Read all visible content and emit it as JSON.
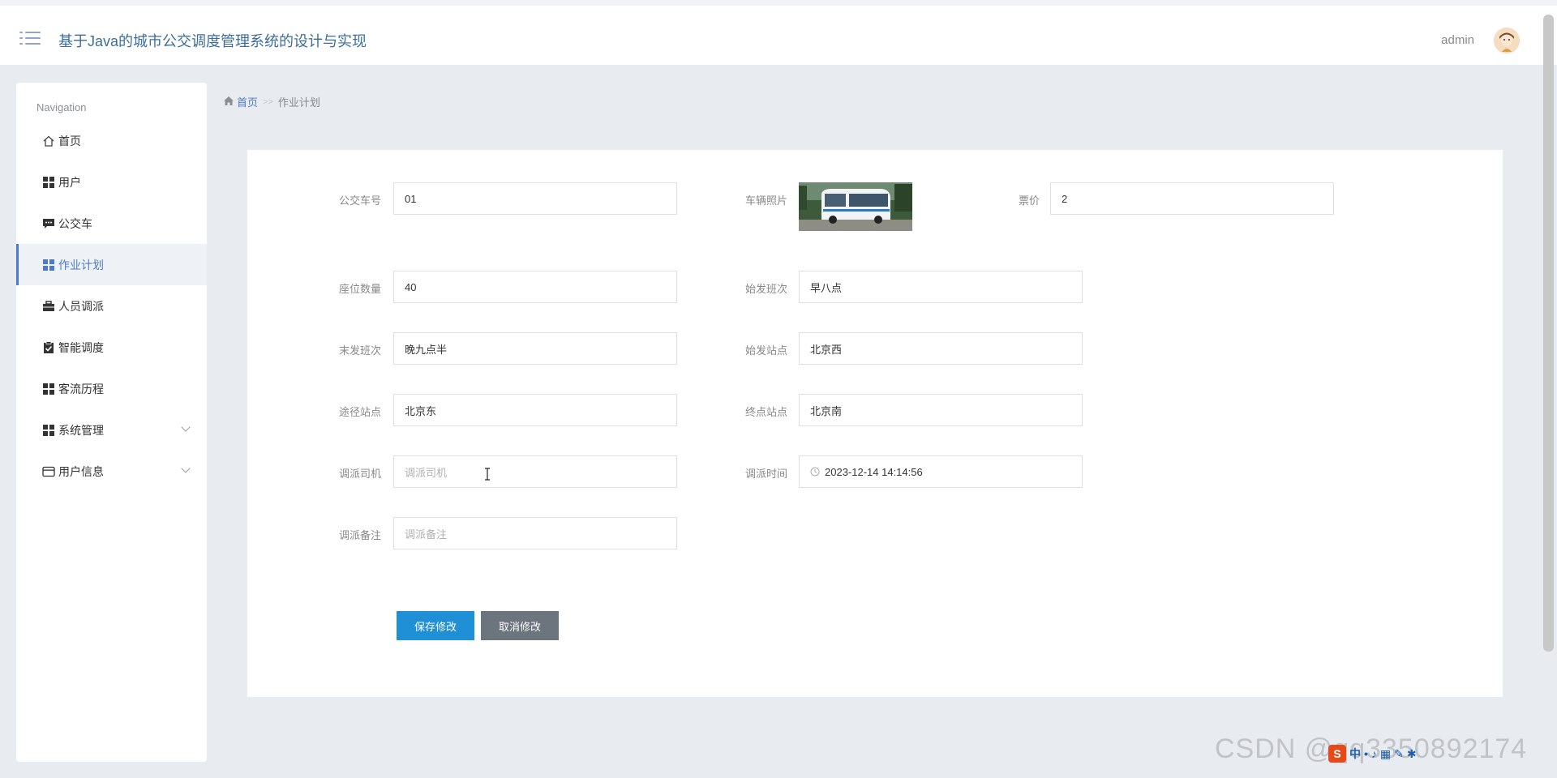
{
  "header": {
    "title": "基于Java的城市公交调度管理系统的设计与实现",
    "user": "admin"
  },
  "sidebar": {
    "heading": "Navigation",
    "items": [
      {
        "label": "首页",
        "icon": "home-icon"
      },
      {
        "label": "用户",
        "icon": "grid-icon"
      },
      {
        "label": "公交车",
        "icon": "chat-icon"
      },
      {
        "label": "作业计划",
        "icon": "grid-icon",
        "active": true
      },
      {
        "label": "人员调派",
        "icon": "briefcase-icon"
      },
      {
        "label": "智能调度",
        "icon": "clipboard-check-icon"
      },
      {
        "label": "客流历程",
        "icon": "grid-icon"
      },
      {
        "label": "系统管理",
        "icon": "grid-icon",
        "expandable": true
      },
      {
        "label": "用户信息",
        "icon": "id-card-icon",
        "expandable": true
      }
    ]
  },
  "breadcrumb": {
    "home": "首页",
    "separator": ">>",
    "current": "作业计划"
  },
  "form": {
    "bus_no": {
      "label": "公交车号",
      "value": "01"
    },
    "photo": {
      "label": "车辆照片"
    },
    "fare": {
      "label": "票价",
      "value": "2"
    },
    "seats": {
      "label": "座位数量",
      "value": "40"
    },
    "first_shift": {
      "label": "始发班次",
      "value": "早八点"
    },
    "last_shift": {
      "label": "末发班次",
      "value": "晚九点半"
    },
    "start_station": {
      "label": "始发站点",
      "value": "北京西"
    },
    "via_station": {
      "label": "途径站点",
      "value": "北京东"
    },
    "end_station": {
      "label": "终点站点",
      "value": "北京南"
    },
    "driver": {
      "label": "调派司机",
      "placeholder": "调派司机"
    },
    "dispatch_time": {
      "label": "调派时间",
      "value": "2023-12-14 14:14:56"
    },
    "remark": {
      "label": "调派备注",
      "placeholder": "调派备注"
    }
  },
  "buttons": {
    "save": "保存修改",
    "cancel": "取消修改"
  },
  "watermark": "CSDN @qq3350892174",
  "colors": {
    "accent": "#4e7bc8",
    "save_button": "#1f8fd6",
    "cancel_button": "#6c757d",
    "title": "#3c6e9c"
  }
}
